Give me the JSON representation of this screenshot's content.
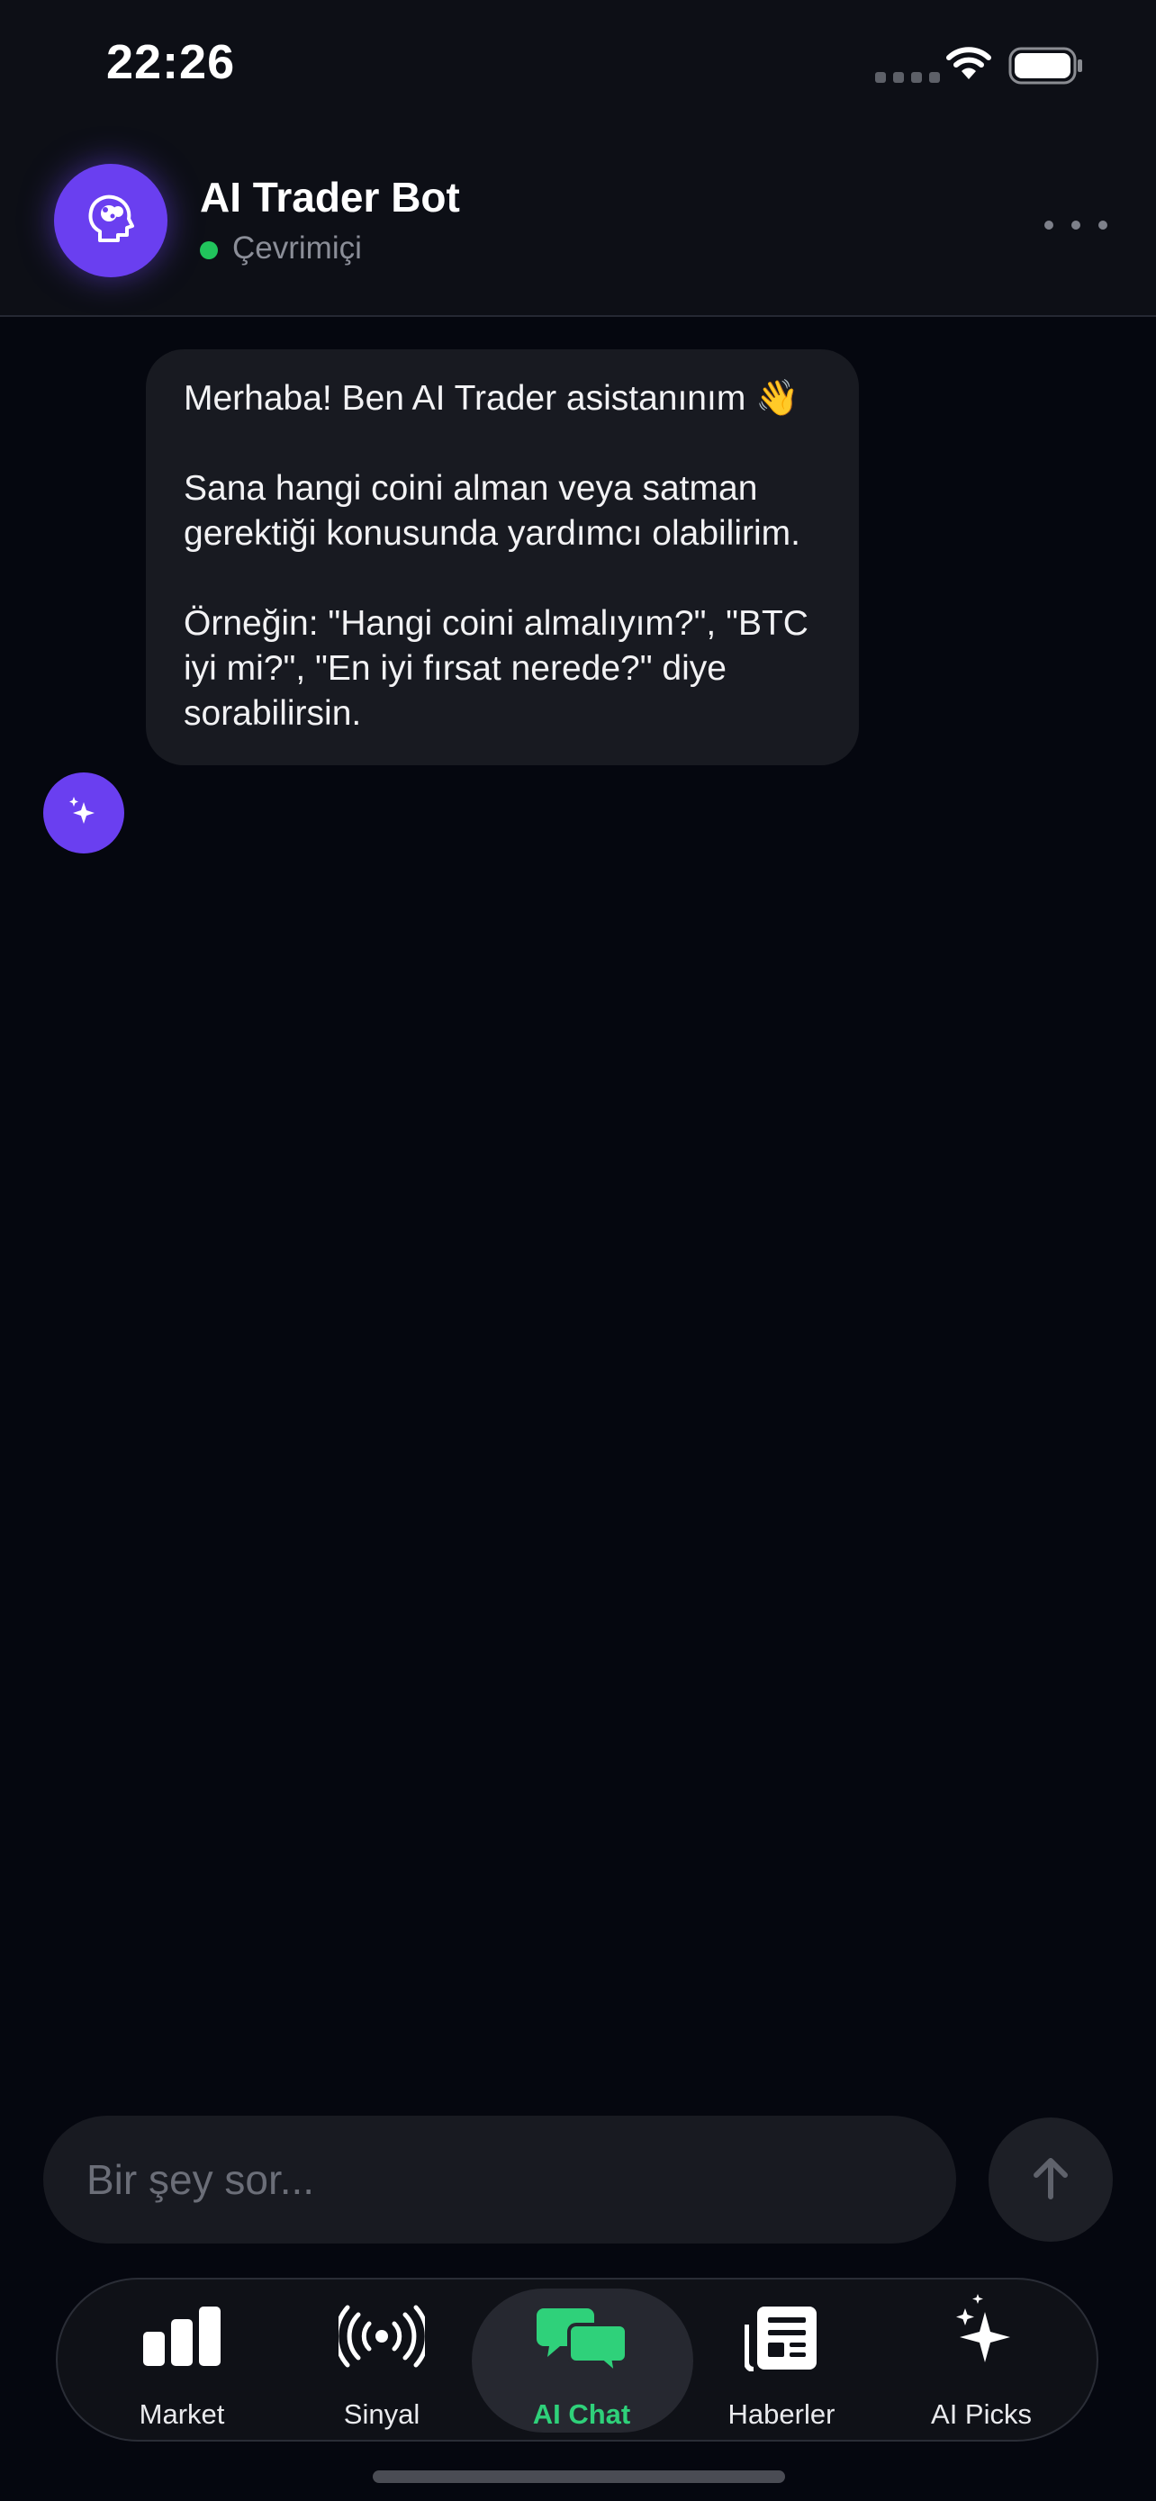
{
  "status_bar": {
    "time": "22:26"
  },
  "header": {
    "bot_name": "AI Trader Bot",
    "status": "Çevrimiçi",
    "status_color": "#21c45c",
    "avatar_icon": "brain-head-icon",
    "accent": "#6a3ff0"
  },
  "messages": [
    {
      "sender": "bot",
      "avatar_icon": "sparkles-icon",
      "paragraphs": [
        "Merhaba! Ben AI Trader asistanınım 👋",
        "Sana hangi coini alman veya satman gerektiği konusunda yardımcı olabilirim.",
        "Örneğin: \"Hangi coini almalıyım?\", \"BTC iyi mi?\", \"En iyi fırsat nerede?\" diye sorabilirsin."
      ]
    }
  ],
  "composer": {
    "placeholder": "Bir şey sor...",
    "value": "",
    "send_icon": "arrow-up-icon"
  },
  "tabbar": {
    "active_color": "#2fd17a",
    "items": [
      {
        "label": "Market",
        "icon": "bar-chart-icon"
      },
      {
        "label": "Sinyal",
        "icon": "broadcast-icon"
      },
      {
        "label": "AI Chat",
        "icon": "chat-bubbles-icon",
        "active": true
      },
      {
        "label": "Haberler",
        "icon": "newspaper-icon"
      },
      {
        "label": "AI Picks",
        "icon": "sparkles-icon"
      }
    ]
  }
}
